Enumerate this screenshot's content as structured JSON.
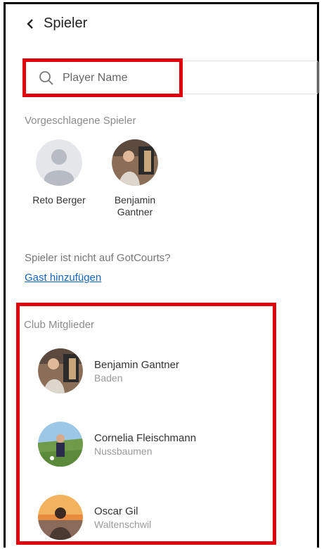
{
  "header": {
    "title": "Spieler",
    "back_icon": "chevron-left-icon"
  },
  "search": {
    "placeholder": "Player Name",
    "value": "",
    "icon": "search-icon"
  },
  "suggested": {
    "label": "Vorgeschlagene Spieler",
    "players": [
      {
        "name": "Reto Berger",
        "avatar": "default-avatar-icon"
      },
      {
        "name": "Benjamin Gantner",
        "avatar": "photo"
      }
    ]
  },
  "guest": {
    "question": "Spieler ist nicht auf GotCourts?",
    "link": "Gast hinzufügen"
  },
  "members": {
    "label": "Club Mitglieder",
    "items": [
      {
        "name": "Benjamin Gantner",
        "city": "Baden"
      },
      {
        "name": "Cornelia Fleischmann",
        "city": "Nussbaumen"
      },
      {
        "name": "Oscar Gil",
        "city": "Waltenschwil"
      }
    ]
  },
  "colors": {
    "highlight": "#e0000b",
    "link": "#1565c0",
    "muted": "#8c8c8c"
  }
}
